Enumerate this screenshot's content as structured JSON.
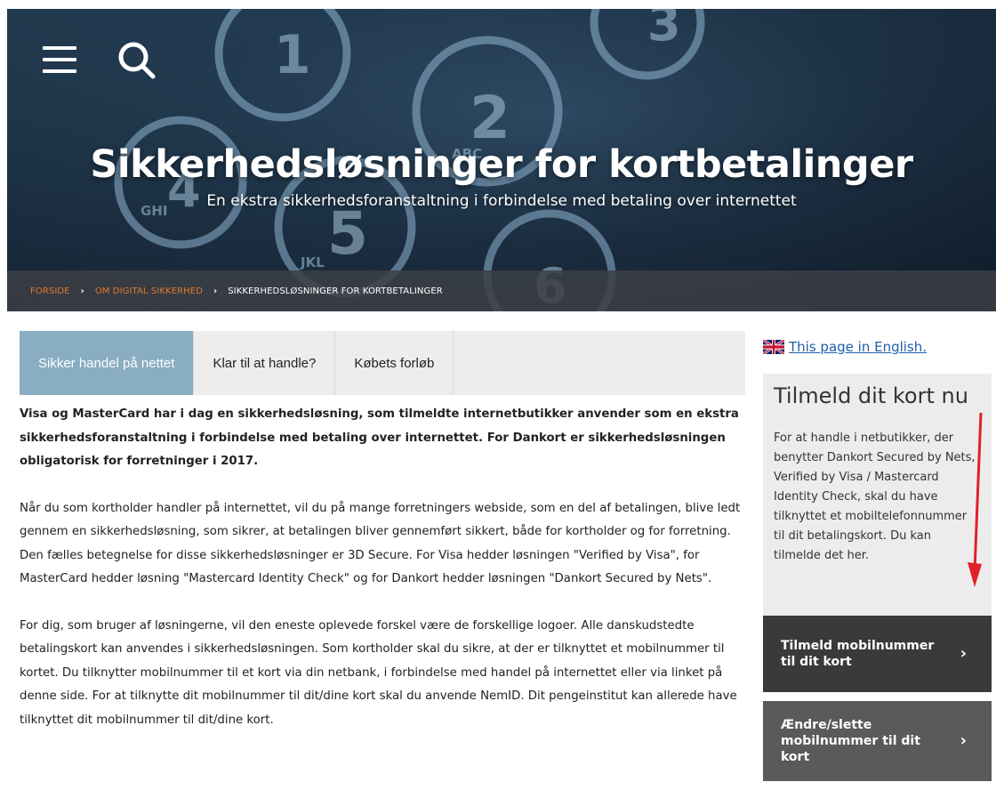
{
  "hero": {
    "title": "Sikkerhedsløsninger for kortbetalinger",
    "subtitle": "En ekstra sikkerhedsforanstaltning i forbindelse med betaling over internettet",
    "keypad_digits": [
      "1",
      "2",
      "3",
      "4",
      "5",
      "6"
    ],
    "keypad_letters": [
      "ABC",
      "GHI",
      "JKL"
    ]
  },
  "breadcrumb": {
    "items": [
      "FORSIDE",
      "OM DIGITAL SIKKERHED"
    ],
    "separator": "›",
    "current": "SIKKERHEDSLØSNINGER FOR KORTBETALINGER"
  },
  "tabs": [
    {
      "label": "Sikker handel på nettet",
      "active": true
    },
    {
      "label": "Klar til at handle?",
      "active": false
    },
    {
      "label": "Købets forløb",
      "active": false
    }
  ],
  "content": {
    "lead": "Visa og MasterCard har i dag en sikkerhedsløsning, som tilmeldte internetbutikker anvender som en ekstra sikkerhedsforanstaltning i forbindelse med betaling over internettet. For Dankort er sikkerhedsløsningen obligatorisk for forretninger i 2017.",
    "p1": "Når du som kortholder handler på internettet, vil du på mange forretningers webside, som en del af betalingen, blive ledt gennem en sikkerhedsløsning, som sikrer, at betalingen bliver gennemført sikkert, både for kortholder og for forretning. Den fælles betegnelse for disse sikkerhedsløsninger er 3D Secure. For Visa hedder løsningen \"Verified by Visa\", for MasterCard hedder løsning \"Mastercard Identity Check\" og for Dankort hedder løsningen \"Dankort Secured by Nets\".",
    "p2": "For dig, som bruger af løsningerne, vil den eneste oplevede forskel være de forskellige logoer. Alle danskudstedte betalingskort kan anvendes i sikkerhedsløsningen. Som kortholder skal du sikre, at der er tilknyttet et mobilnummer til kortet. Du tilknytter mobilnummer til et kort via din netbank, i forbindelse med handel på internettet eller via linket på denne side. For at tilknytte dit mobilnummer til dit/dine kort skal du anvende NemID. Dit pengeinstitut kan allerede have tilknyttet dit mobilnummer til dit/dine kort."
  },
  "sidebar": {
    "english_link": "This page in English.",
    "box_title": "Tilmeld dit kort nu",
    "box_text": "For at handle i netbutikker, der benytter Dankort Secured by Nets, Verified by Visa / Mastercard Identity Check, skal du have tilknyttet et mobiltelefonnummer til dit betalingskort. Du kan tilmelde det her.",
    "cta_primary": "Tilmeld mobilnummer til dit kort",
    "cta_secondary": "Ændre/slette mobilnummer til dit kort",
    "cta_chevron": "›"
  },
  "colors": {
    "active_tab": "#89aec2",
    "breadcrumb_link": "#e07a2a",
    "cta_dark": "#3a3a3a",
    "cta_mid": "#5a5a5a",
    "annotation_arrow": "#e0202a"
  }
}
